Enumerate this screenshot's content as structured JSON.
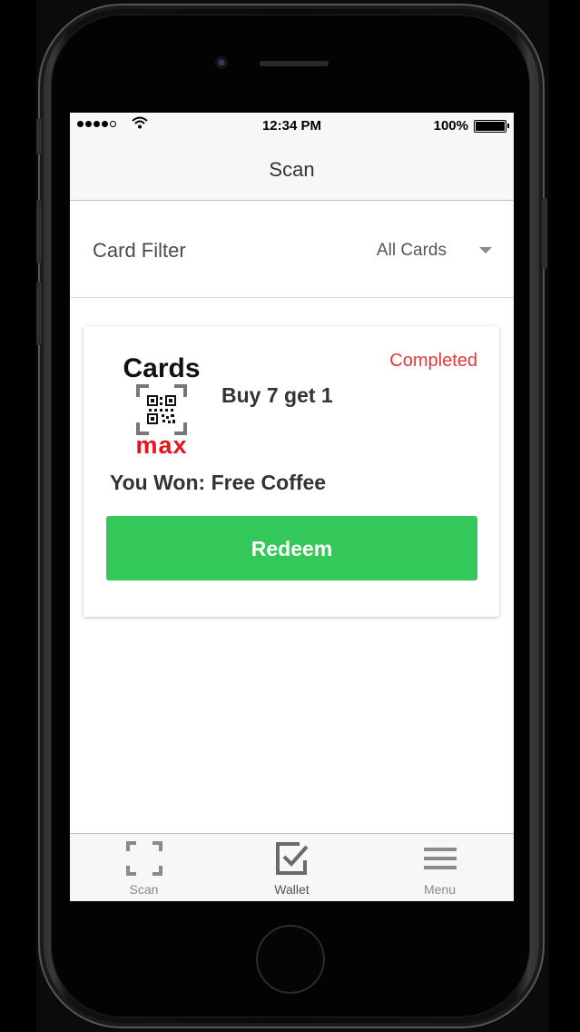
{
  "status_bar": {
    "time": "12:34 PM",
    "battery": "100%"
  },
  "nav": {
    "title": "Scan"
  },
  "filter": {
    "label": "Card Filter",
    "value": "All Cards"
  },
  "card": {
    "logo_top": "Cards",
    "logo_bottom": "max",
    "name": "Buy 7 get 1",
    "status": "Completed",
    "won": "You Won: Free Coffee",
    "redeem_label": "Redeem"
  },
  "tab_bar": {
    "tabs": [
      {
        "label": "Scan",
        "icon": "scan-icon"
      },
      {
        "label": "Wallet",
        "icon": "wallet-check-icon",
        "active": true
      },
      {
        "label": "Menu",
        "icon": "menu-icon"
      }
    ]
  },
  "colors": {
    "accent_green": "#34c759",
    "status_red": "#e53935",
    "logo_red": "#e5141e"
  }
}
